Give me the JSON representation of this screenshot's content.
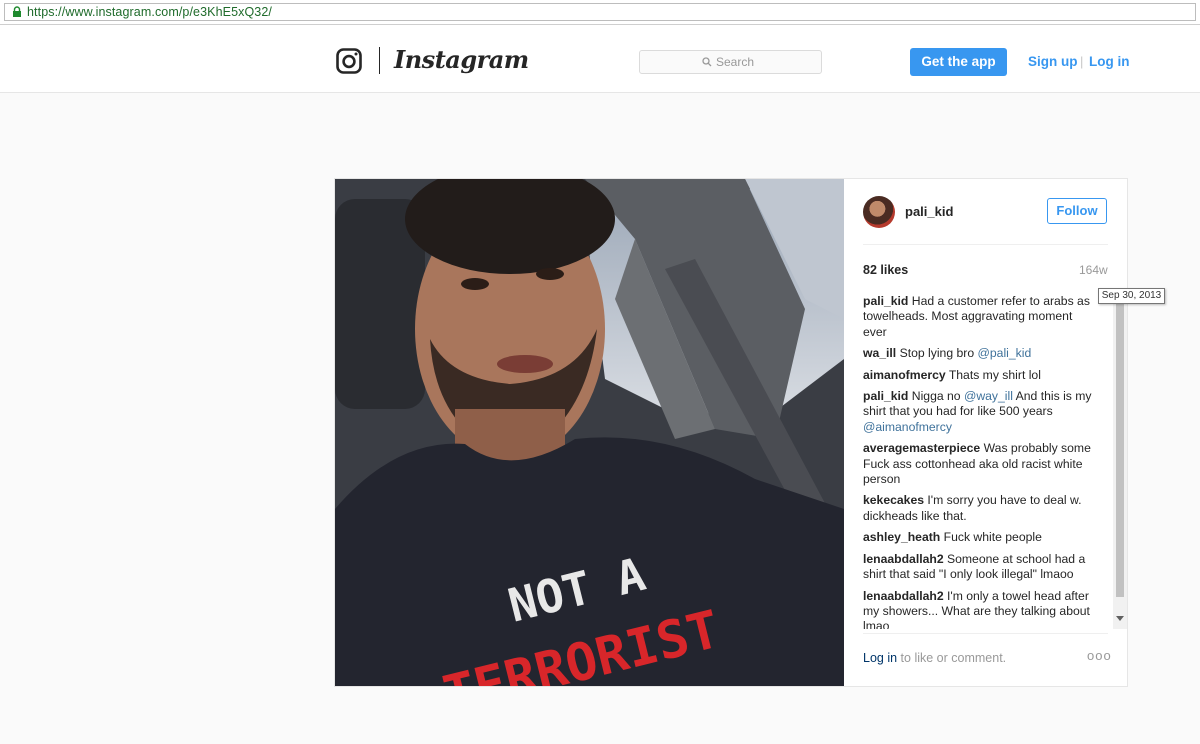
{
  "browser": {
    "url": "https://www.instagram.com/p/e3KhE5xQ32/"
  },
  "header": {
    "brand": "Instagram",
    "search_placeholder": "Search",
    "get_app_label": "Get the app",
    "signup_label": "Sign up",
    "separator": "|",
    "login_label": "Log in"
  },
  "post": {
    "username": "pali_kid",
    "follow_label": "Follow",
    "likes": "82 likes",
    "age": "164w",
    "date_tooltip": "Sep 30, 2013",
    "shirt_text_line1": "NOT A",
    "shirt_text_line2": "TERRORIST",
    "comments": [
      {
        "user": "pali_kid",
        "text": "Had a customer refer to arabs as towelheads. Most aggravating moment ever"
      },
      {
        "user": "wa_ill",
        "text": "Stop lying bro",
        "mention": "@pali_kid"
      },
      {
        "user": "aimanofmercy",
        "text": "Thats my shirt lol"
      },
      {
        "user": "pali_kid",
        "text_before": "Nigga no",
        "mention": "@way_ill",
        "text_after": "And this is my shirt that you had for like 500 years",
        "mention2": "@aimanofmercy"
      },
      {
        "user": "averagemasterpiece",
        "text": "Was probably some Fuck ass cottonhead aka old racist white person"
      },
      {
        "user": "kekecakes",
        "text": "I'm sorry you have to deal w. dickheads like that."
      },
      {
        "user": "ashley_heath",
        "text": "Fuck white people"
      },
      {
        "user": "lenaabdallah2",
        "text": "Someone at school had a shirt that said \"I only look illegal\" lmaoo"
      },
      {
        "user": "lenaabdallah2",
        "text": "I'm only a towel head after my showers... What are they talking about lmao"
      }
    ],
    "footer_login": "Log in",
    "footer_text": "to like or comment.",
    "more_label": "ooo"
  }
}
